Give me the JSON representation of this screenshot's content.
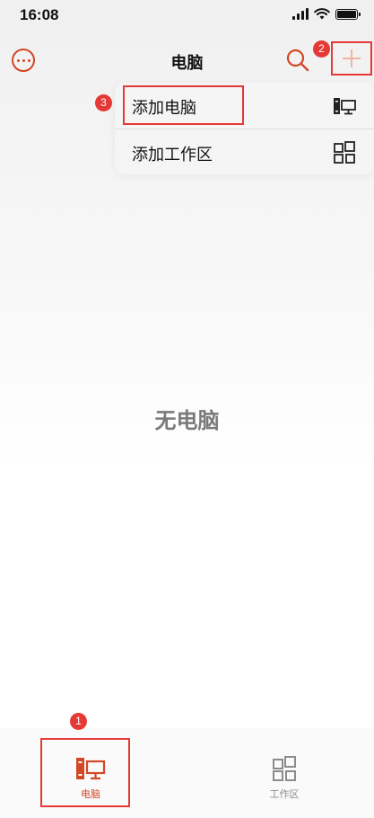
{
  "status_bar": {
    "time": "16:08"
  },
  "header": {
    "title": "电脑"
  },
  "dropdown_menu": {
    "items": [
      {
        "label": "添加电脑",
        "icon": "computer-icon"
      },
      {
        "label": "添加工作区",
        "icon": "workspace-grid-icon"
      }
    ]
  },
  "main": {
    "empty_text": "无电脑"
  },
  "tab_bar": {
    "tabs": [
      {
        "label": "电脑",
        "icon": "computer-icon",
        "active": true
      },
      {
        "label": "工作区",
        "icon": "workspace-grid-icon",
        "active": false
      }
    ]
  },
  "annotations": {
    "badge_1": "1",
    "badge_2": "2",
    "badge_3": "3"
  },
  "colors": {
    "accent": "#d24726",
    "annotation_red": "#e53935",
    "inactive": "#8c8c8c"
  }
}
